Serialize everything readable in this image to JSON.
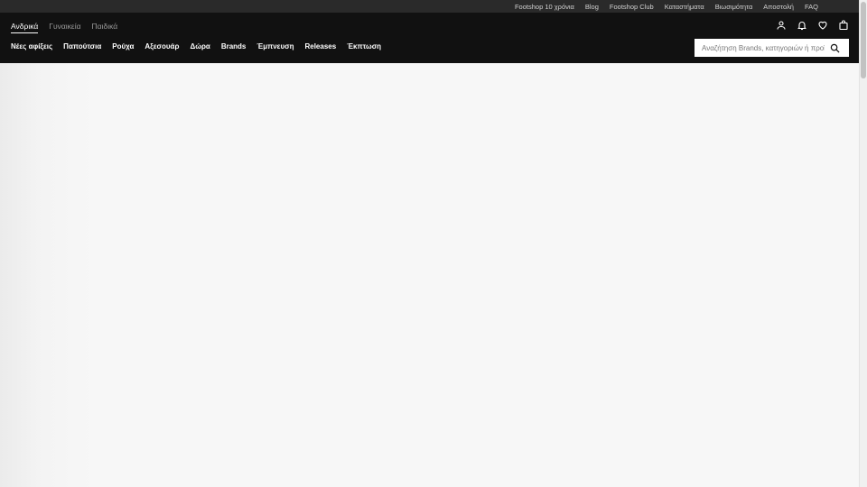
{
  "topbar": {
    "links": [
      "Footshop 10 χρόνια",
      "Blog",
      "Footshop Club",
      "Καταστήματα",
      "Βιωσιμότητα",
      "Αποστολή",
      "FAQ"
    ]
  },
  "header": {
    "gender_tabs": [
      "Ανδρικά",
      "Γυναικεία",
      "Παιδικά"
    ],
    "active_gender": "Ανδρικά",
    "nav": [
      "Νέες αφίξεις",
      "Παπούτσια",
      "Ρούχα",
      "Αξεσουάρ",
      "Δώρα",
      "Brands",
      "Έμπνευση",
      "Releases",
      "Έκπτωση"
    ],
    "icons": [
      "user-icon",
      "bell-icon",
      "heart-icon",
      "bag-icon"
    ]
  },
  "search": {
    "placeholder": "Αναζήτηση Brands, κατηγοριών ή προϊόντ",
    "icon": "search-icon"
  },
  "colors": {
    "header_bg": "#111111",
    "topbar_bg": "#2a2a2a",
    "content_bg": "#f7f7f7"
  }
}
